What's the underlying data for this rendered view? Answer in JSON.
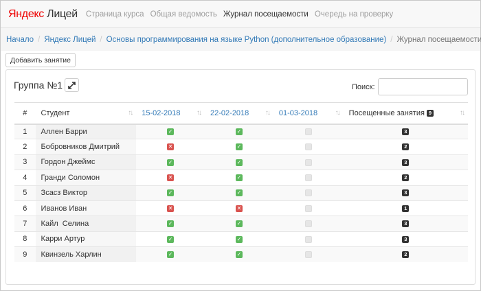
{
  "nav": {
    "logo_ya": "Яндекс",
    "logo_rest": " Лицей",
    "links": [
      {
        "label": "Страница курса",
        "active": false
      },
      {
        "label": "Общая ведомость",
        "active": false
      },
      {
        "label": "Журнал посещаемости",
        "active": true
      },
      {
        "label": "Очередь на проверку",
        "active": false
      }
    ]
  },
  "breadcrumb": {
    "items": [
      "Начало",
      "Яндекс Лицей",
      "Основы программирования на языке Python (дополнительное образование)"
    ],
    "current": "Журнал посещаемости"
  },
  "toolbar": {
    "add_label": "Добавить занятие"
  },
  "panel": {
    "title": "Группа №1",
    "search_label": "Поиск:",
    "search_value": "",
    "search_placeholder": ""
  },
  "table": {
    "headers": {
      "num": "#",
      "student": "Студент",
      "dates": [
        "15-02-2018",
        "22-02-2018",
        "01-03-2018"
      ],
      "attended": "Посещенные занятия",
      "attended_total": "9"
    },
    "rows": [
      {
        "num": "1",
        "name": "Аллен Барри",
        "marks": [
          "yes",
          "yes",
          "none"
        ],
        "count": "3"
      },
      {
        "num": "2",
        "name": "Бобровников Дмитрий",
        "marks": [
          "no",
          "yes",
          "none"
        ],
        "count": "2"
      },
      {
        "num": "3",
        "name": "Гордон Джеймс",
        "marks": [
          "yes",
          "yes",
          "none"
        ],
        "count": "3"
      },
      {
        "num": "4",
        "name": "Гранди Соломон",
        "marks": [
          "no",
          "yes",
          "none"
        ],
        "count": "2"
      },
      {
        "num": "5",
        "name": "Зсасз Виктор",
        "marks": [
          "yes",
          "yes",
          "none"
        ],
        "count": "3"
      },
      {
        "num": "6",
        "name": "Иванов Иван",
        "marks": [
          "no",
          "no",
          "none"
        ],
        "count": "1"
      },
      {
        "num": "7",
        "name": "Кайл  Селина",
        "marks": [
          "yes",
          "yes",
          "none"
        ],
        "count": "3"
      },
      {
        "num": "8",
        "name": "Карри Артур",
        "marks": [
          "yes",
          "yes",
          "none"
        ],
        "count": "3"
      },
      {
        "num": "9",
        "name": "Квинзель Харлин",
        "marks": [
          "yes",
          "yes",
          "none"
        ],
        "count": "2"
      }
    ]
  },
  "colors": {
    "link": "#337ab7",
    "ok": "#5cb85c",
    "no": "#d9534f",
    "badge": "#333333",
    "logo_red": "#ee0000"
  }
}
